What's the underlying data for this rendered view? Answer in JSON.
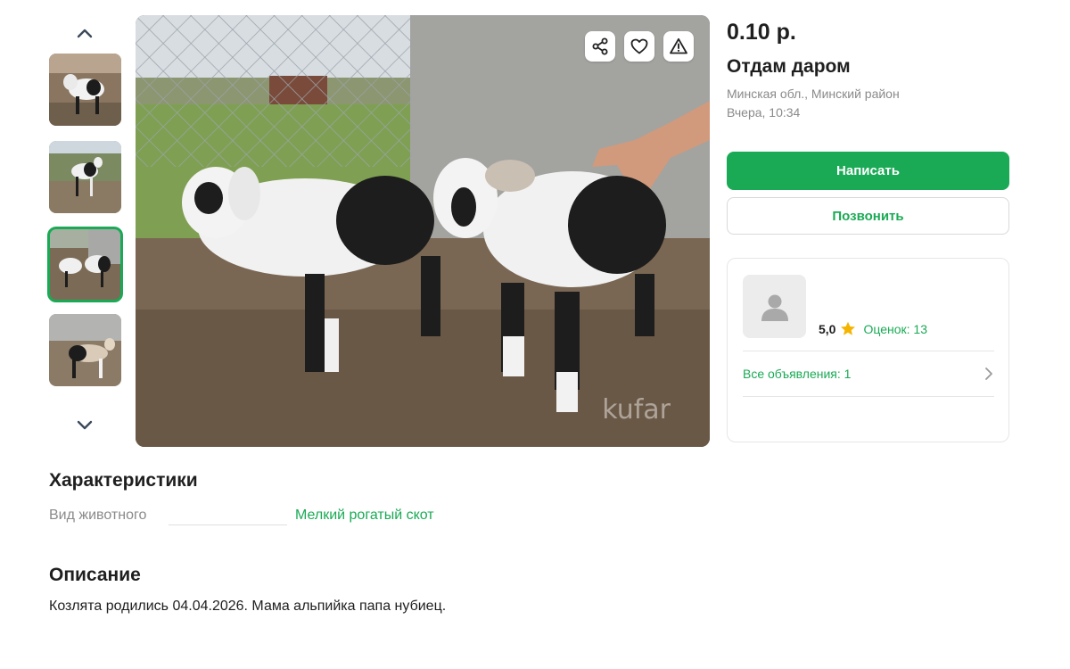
{
  "gallery": {
    "thumbnails": [
      {
        "name": "photo-1",
        "active": false
      },
      {
        "name": "photo-2",
        "active": false
      },
      {
        "name": "photo-3",
        "active": true
      },
      {
        "name": "photo-4",
        "active": false
      }
    ],
    "watermark": "kufar"
  },
  "listing": {
    "price": "0.10 р.",
    "title": "Отдам даром",
    "location": "Минская обл., Минский район",
    "date": "Вчера, 10:34"
  },
  "actions": {
    "write_label": "Написать",
    "call_label": "Позвонить"
  },
  "seller": {
    "rating": "5,0",
    "ratings_count": "Оценок: 13",
    "all_ads": "Все объявления: 1"
  },
  "characteristics": {
    "title": "Характеристики",
    "rows": [
      {
        "label": "Вид животного",
        "value": "Мелкий рогатый скот"
      }
    ]
  },
  "description": {
    "title": "Описание",
    "text": "Козлята родились 04.04.2026. Мама альпийка папа нубиец."
  },
  "colors": {
    "accent": "#1aaa55",
    "muted_text": "#8a8a8a",
    "star": "#f5b400"
  },
  "icons": [
    "chevron-up-icon",
    "chevron-down-icon",
    "share-icon",
    "heart-icon",
    "warning-icon",
    "user-icon",
    "star-icon",
    "chevron-right-icon"
  ]
}
